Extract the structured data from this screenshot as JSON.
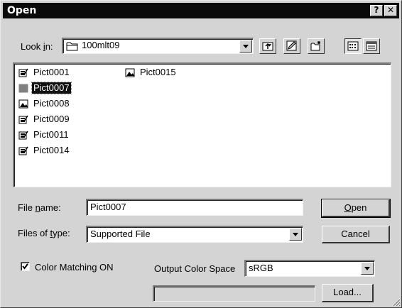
{
  "window": {
    "title": "Open",
    "help_label": "?",
    "close_label": "✕"
  },
  "look_in": {
    "label_pre": "Look ",
    "label_key": "i",
    "label_post": "n:",
    "value": "100mlt09"
  },
  "toolbar": {
    "icons": [
      "up-folder-icon",
      "edit-icon",
      "new-folder-icon",
      "list-view-icon",
      "details-view-icon"
    ]
  },
  "files": [
    {
      "name": "Pict0001",
      "icon": "edit-file-icon",
      "selected": false
    },
    {
      "name": "Pict0007",
      "icon": "image-file-icon",
      "selected": true
    },
    {
      "name": "Pict0008",
      "icon": "image-file-icon",
      "selected": false
    },
    {
      "name": "Pict0009",
      "icon": "edit-file-icon",
      "selected": false
    },
    {
      "name": "Pict0011",
      "icon": "edit-file-icon",
      "selected": false
    },
    {
      "name": "Pict0014",
      "icon": "edit-file-icon",
      "selected": false
    },
    {
      "name": "Pict0015",
      "icon": "image-file-icon",
      "selected": false
    }
  ],
  "file_name": {
    "label_pre": "File ",
    "label_key": "n",
    "label_post": "ame:",
    "value": "Pict0007"
  },
  "file_type": {
    "label_pre": "Files of ",
    "label_key": "t",
    "label_post": "ype:",
    "value": "Supported File"
  },
  "buttons": {
    "open_key": "O",
    "open_rest": "pen",
    "cancel": "Cancel",
    "load": "Load..."
  },
  "color_matching": {
    "label": "Color Matching ON",
    "checked": true
  },
  "output_color_space": {
    "label": "Output Color Space",
    "value": "sRGB"
  },
  "load_path": {
    "value": ""
  }
}
